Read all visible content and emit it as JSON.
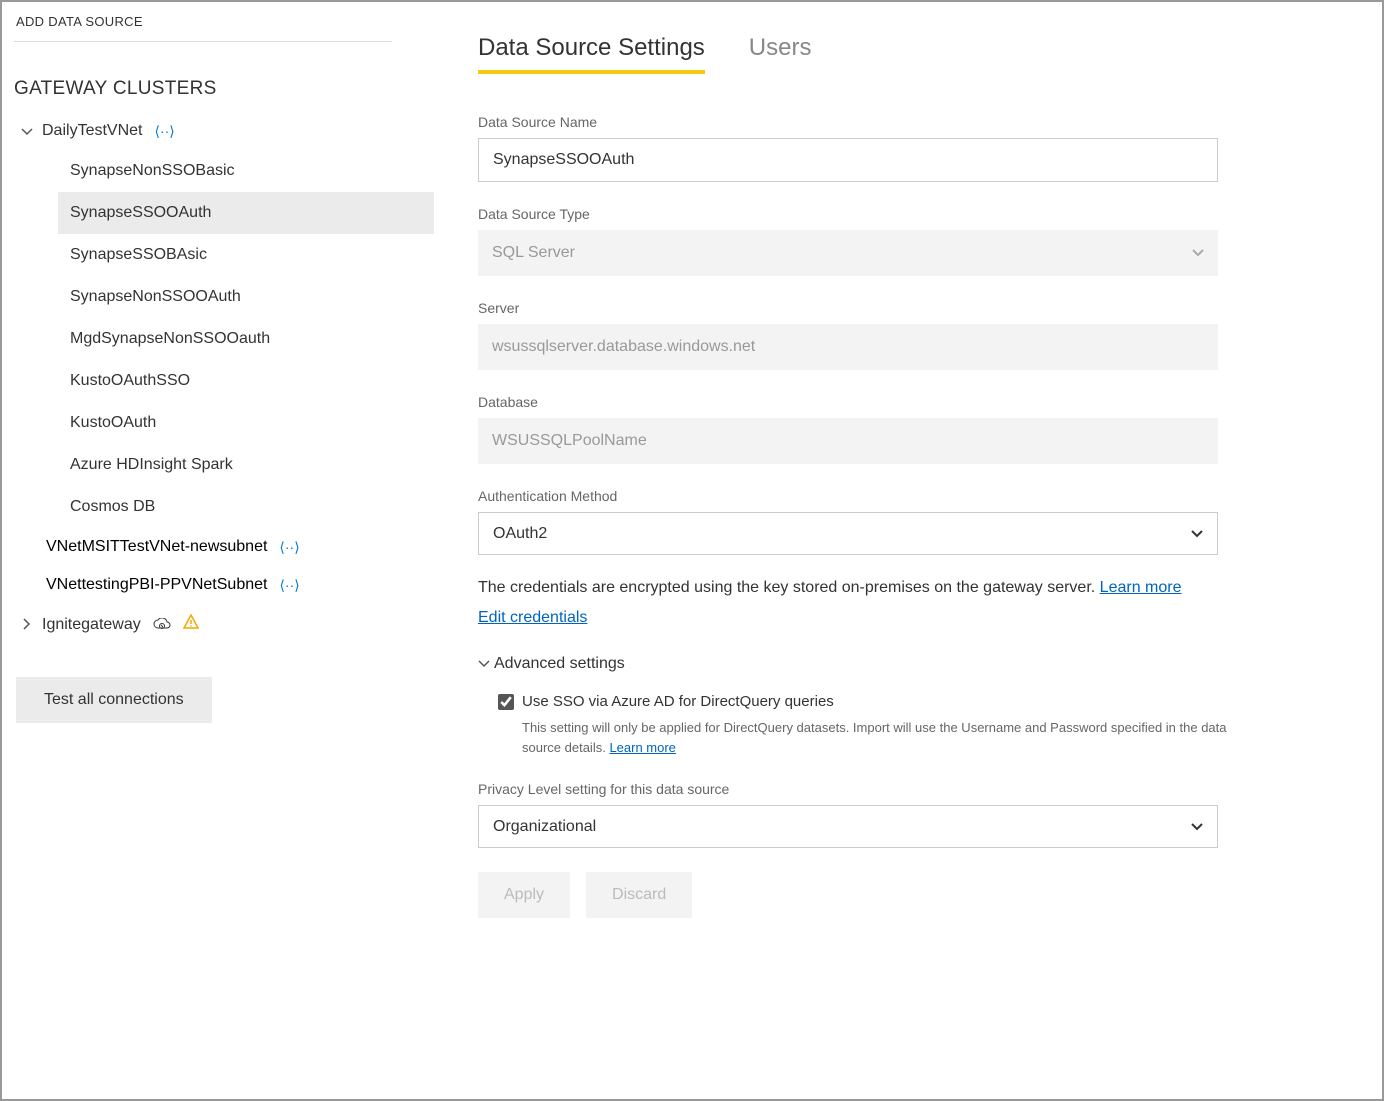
{
  "sidebar": {
    "add_data_source": "ADD DATA SOURCE",
    "gateway_clusters_header": "GATEWAY CLUSTERS",
    "clusters": [
      {
        "name": "DailyTestVNet",
        "expanded": true,
        "has_vnet_icon": true,
        "data_sources": [
          "SynapseNonSSOBasic",
          "SynapseSSOOAuth",
          "SynapseSSOBAsic",
          "SynapseNonSSOOAuth",
          "MgdSynapseNonSSOOauth",
          "KustoOAuthSSO",
          "KustoOAuth",
          "Azure HDInsight Spark",
          "Cosmos DB"
        ],
        "selected_index": 1,
        "sub_clusters": [
          {
            "name": "VNetMSITTestVNet-newsubnet",
            "has_vnet_icon": true
          },
          {
            "name": "VNettestingPBI-PPVNetSubnet",
            "has_vnet_icon": true
          }
        ]
      },
      {
        "name": "Ignitegateway",
        "expanded": false,
        "has_cloud_icon": true,
        "has_warning": true
      }
    ],
    "test_button": "Test all connections"
  },
  "tabs": {
    "settings": "Data Source Settings",
    "users": "Users"
  },
  "form": {
    "ds_name_label": "Data Source Name",
    "ds_name_value": "SynapseSSOOAuth",
    "ds_type_label": "Data Source Type",
    "ds_type_value": "SQL Server",
    "server_label": "Server",
    "server_value": "wsussqlserver.database.windows.net",
    "database_label": "Database",
    "database_value": "WSUSSQLPoolName",
    "auth_label": "Authentication Method",
    "auth_value": "OAuth2",
    "cred_text": "The credentials are encrypted using the key stored on-premises on the gateway server. ",
    "learn_more": "Learn more",
    "edit_credentials": "Edit credentials",
    "advanced_toggle": "Advanced settings",
    "sso_checkbox_label": "Use SSO via Azure AD for DirectQuery queries",
    "sso_checked": true,
    "sso_help_text": "This setting will only be applied for DirectQuery datasets. Import will use the Username and Password specified in the data source details. ",
    "privacy_label": "Privacy Level setting for this data source",
    "privacy_value": "Organizational",
    "apply": "Apply",
    "discard": "Discard"
  }
}
